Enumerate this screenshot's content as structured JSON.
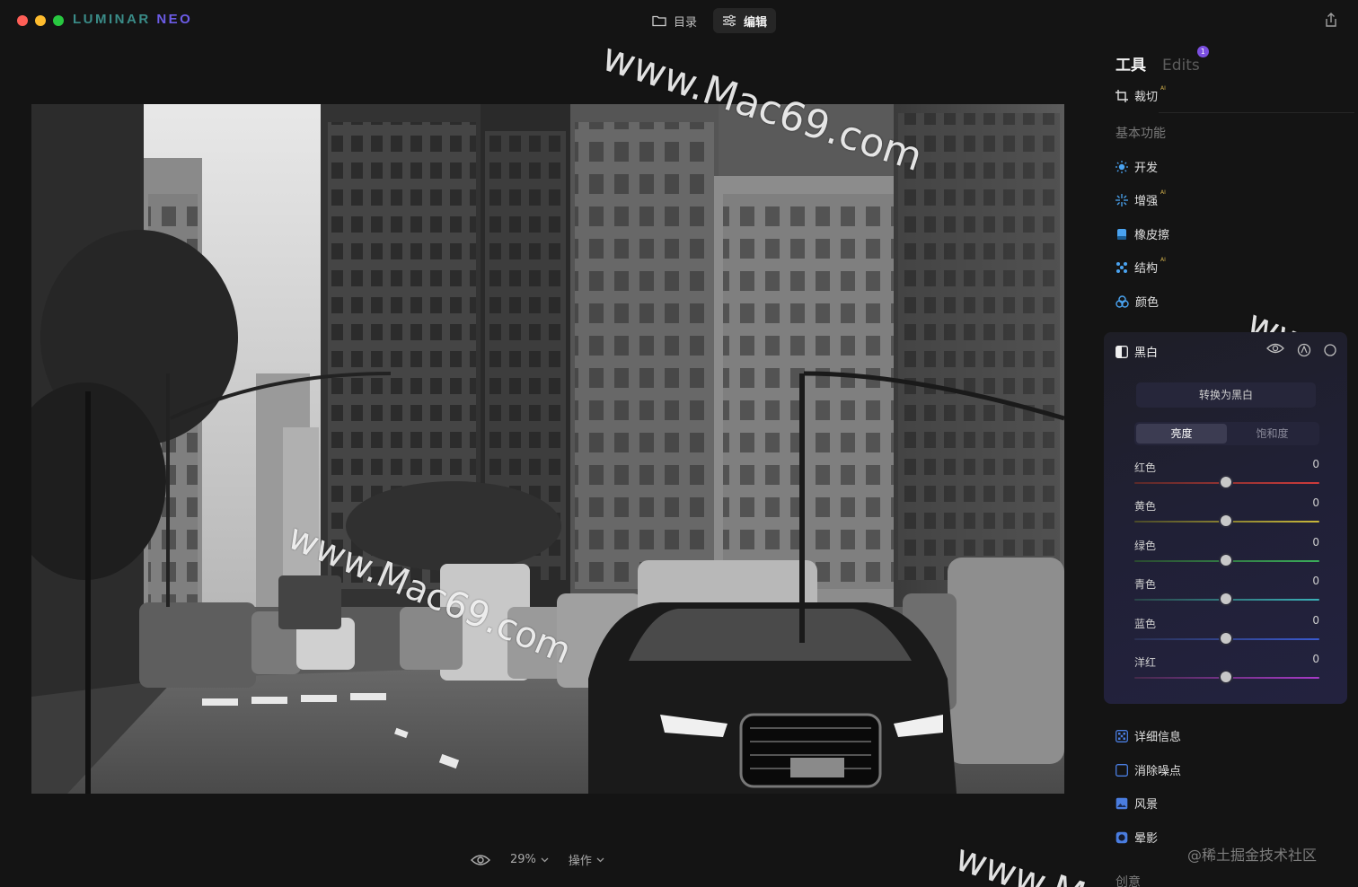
{
  "app": {
    "logo_part1": "LUMINAR ",
    "logo_part2": "NEO",
    "traffic_colors": [
      "#ff5f57",
      "#febc2e",
      "#28c840"
    ]
  },
  "topnav": {
    "catalog": "目录",
    "edit": "编辑"
  },
  "bottombar": {
    "zoom": "29%",
    "actions": "操作"
  },
  "panel": {
    "tab_tools": "工具",
    "tab_edits": "Edits",
    "edits_badge": "1",
    "crop": "裁切",
    "ai_mark": "AI",
    "section_essentials": "基本功能",
    "essentials": [
      {
        "label": "开发",
        "icon": "sun-icon",
        "ai": false
      },
      {
        "label": "增强",
        "icon": "sparkle-icon",
        "ai": true
      },
      {
        "label": "橡皮擦",
        "icon": "eraser-icon",
        "ai": false
      },
      {
        "label": "结构",
        "icon": "structure-icon",
        "ai": true
      },
      {
        "label": "颜色",
        "icon": "color-icon",
        "ai": false
      }
    ],
    "bw": {
      "title": "黑白",
      "convert": "转换为黑白",
      "seg_luminance": "亮度",
      "seg_saturation": "饱和度",
      "sliders": [
        {
          "label": "红色",
          "value": "0",
          "position": 0.5
        },
        {
          "label": "黄色",
          "value": "0",
          "position": 0.5
        },
        {
          "label": "绿色",
          "value": "0",
          "position": 0.5
        },
        {
          "label": "青色",
          "value": "0",
          "position": 0.5
        },
        {
          "label": "蓝色",
          "value": "0",
          "position": 0.5
        },
        {
          "label": "洋红",
          "value": "0",
          "position": 0.5
        }
      ]
    },
    "more_tools": [
      "详细信息",
      "消除噪点",
      "风景",
      "晕影"
    ],
    "section_creative": "创意"
  },
  "watermarks": [
    "www.Mac69.com",
    "www.Mac69.com",
    "www.",
    "www.M"
  ],
  "footer_credit": "@稀土掘金技术社区"
}
